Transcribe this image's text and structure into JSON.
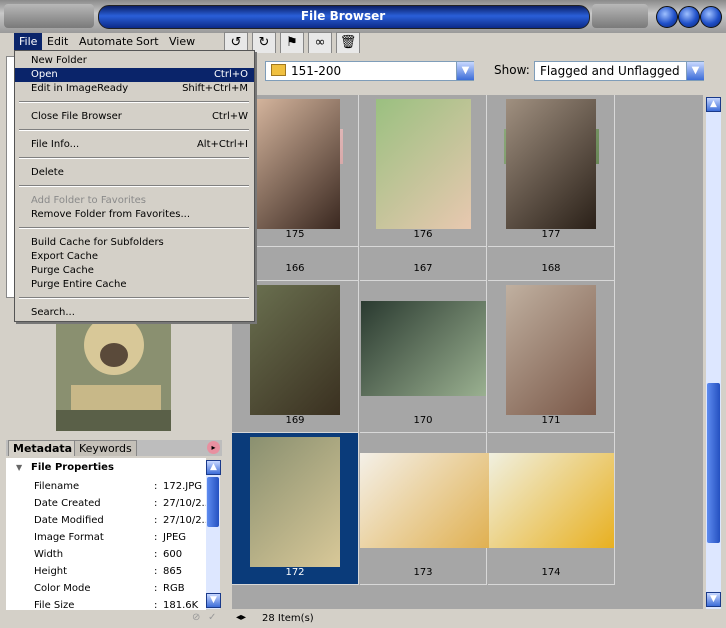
{
  "window": {
    "title": "File Browser"
  },
  "menu": {
    "items": [
      "File",
      "Edit",
      "Automate",
      "Sort",
      "View"
    ]
  },
  "toolbar": {
    "icons": [
      "rotate-ccw-icon",
      "rotate-cw-icon",
      "flag-icon",
      "binoculars-icon",
      "trash-icon"
    ]
  },
  "location": {
    "folder": "151-200",
    "show_label": "Show:",
    "show_value": "Flagged and Unflagged"
  },
  "file_menu": [
    {
      "label": "New Folder",
      "shortcut": "",
      "state": "normal"
    },
    {
      "label": "Open",
      "shortcut": "Ctrl+O",
      "state": "highlighted"
    },
    {
      "label": "Edit in ImageReady",
      "shortcut": "Shift+Ctrl+M",
      "state": "normal"
    },
    {
      "label": "Close File Browser",
      "shortcut": "Ctrl+W",
      "state": "normal"
    },
    {
      "label": "File Info...",
      "shortcut": "Alt+Ctrl+I",
      "state": "normal"
    },
    {
      "label": "Delete",
      "shortcut": "",
      "state": "normal"
    },
    {
      "label": "Add Folder to Favorites",
      "shortcut": "",
      "state": "disabled"
    },
    {
      "label": "Remove Folder from Favorites...",
      "shortcut": "",
      "state": "normal"
    },
    {
      "label": "Build Cache for Subfolders",
      "shortcut": "",
      "state": "normal"
    },
    {
      "label": "Export Cache",
      "shortcut": "",
      "state": "normal"
    },
    {
      "label": "Purge Cache",
      "shortcut": "",
      "state": "normal"
    },
    {
      "label": "Purge Entire Cache",
      "shortcut": "",
      "state": "normal"
    },
    {
      "label": "Search...",
      "shortcut": "",
      "state": "normal"
    }
  ],
  "thumbnails": [
    {
      "label": "166",
      "selected": false
    },
    {
      "label": "167",
      "selected": false
    },
    {
      "label": "168",
      "selected": false
    },
    {
      "label": "169",
      "selected": false
    },
    {
      "label": "170",
      "selected": false
    },
    {
      "label": "171",
      "selected": false
    },
    {
      "label": "172",
      "selected": true
    },
    {
      "label": "173",
      "selected": false
    },
    {
      "label": "174",
      "selected": false
    },
    {
      "label": "175",
      "selected": false
    },
    {
      "label": "176",
      "selected": false
    },
    {
      "label": "177",
      "selected": false
    }
  ],
  "meta": {
    "tabs": [
      "Metadata",
      "Keywords"
    ],
    "section": "File Properties",
    "rows": [
      {
        "key": "Filename",
        "value": "172.JPG"
      },
      {
        "key": "Date Created",
        "value": "27/10/2..."
      },
      {
        "key": "Date Modified",
        "value": "27/10/2..."
      },
      {
        "key": "Image Format",
        "value": "JPEG"
      },
      {
        "key": "Width",
        "value": "600"
      },
      {
        "key": "Height",
        "value": "865"
      },
      {
        "key": "Color Mode",
        "value": "RGB"
      },
      {
        "key": "File Size",
        "value": "181.6K"
      }
    ]
  },
  "status": {
    "items_count": "28 Item(s)"
  }
}
